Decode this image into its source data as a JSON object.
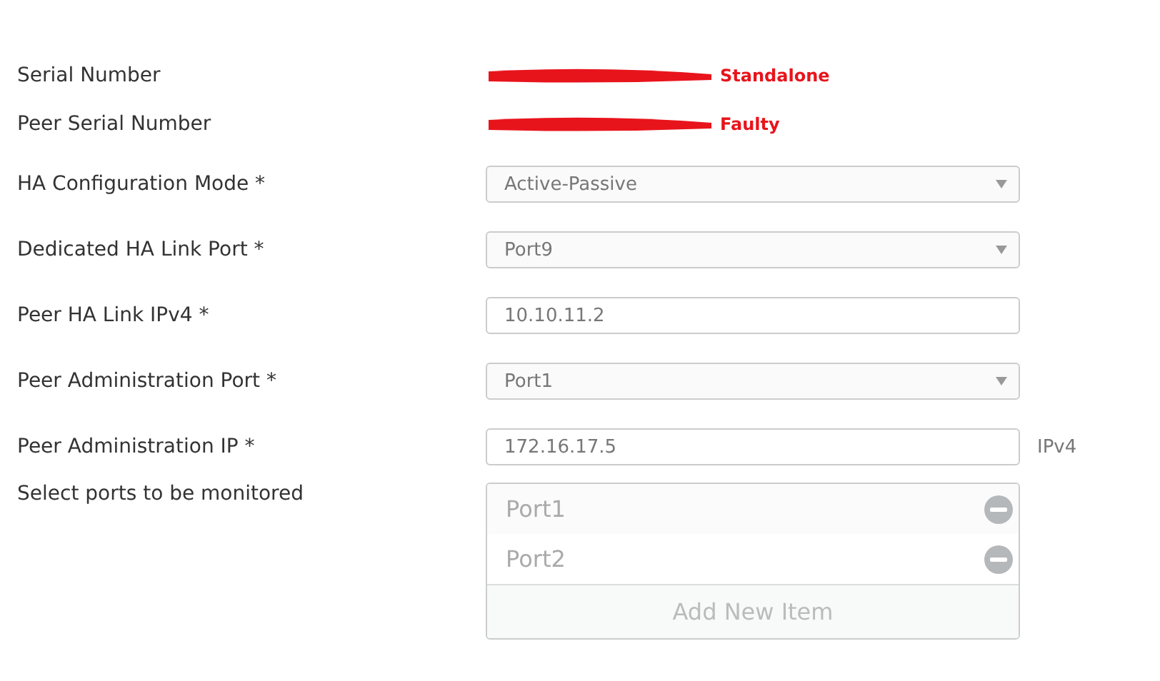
{
  "status_rows": [
    {
      "label": "Serial Number",
      "status": "Standalone"
    },
    {
      "label": "Peer Serial Number",
      "status": "Faulty"
    }
  ],
  "fields": [
    {
      "label": "HA Configuration Mode *",
      "kind": "select",
      "value": "Active-Passive"
    },
    {
      "label": "Dedicated HA Link Port *",
      "kind": "select",
      "value": "Port9"
    },
    {
      "label": "Peer HA Link IPv4 *",
      "kind": "text",
      "value": "10.10.11.2"
    },
    {
      "label": "Peer Administration Port *",
      "kind": "select",
      "value": "Port1"
    },
    {
      "label": "Peer Administration IP *",
      "kind": "text",
      "value": "172.16.17.5",
      "unit": "IPv4"
    }
  ],
  "monitored_ports": {
    "label": "Select ports to be monitored",
    "items": [
      "Port1",
      "Port2"
    ],
    "add_button": "Add New Item"
  }
}
